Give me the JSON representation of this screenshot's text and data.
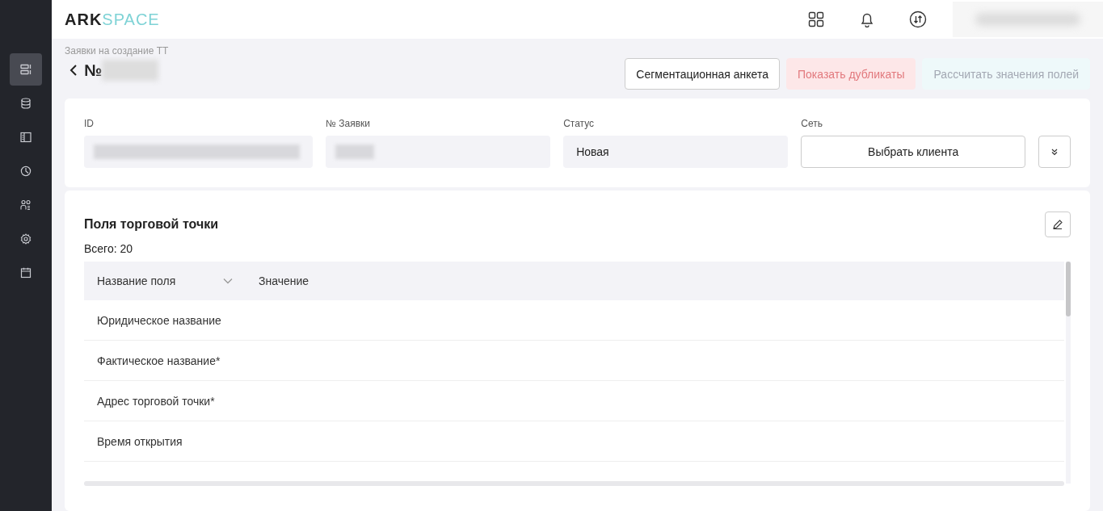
{
  "logo": {
    "part_1": "ARK",
    "part_2": "SPACE"
  },
  "sidebar": {
    "items": [
      {
        "selected": true
      },
      {
        "selected": false
      },
      {
        "selected": false
      },
      {
        "selected": false
      },
      {
        "selected": false
      },
      {
        "selected": false
      },
      {
        "selected": false
      }
    ]
  },
  "breadcrumb": "Заявки на создание ТТ",
  "page_title": "№",
  "actions": [
    {
      "label": "Сегментационная анкета",
      "kind": "outline",
      "disabled": false
    },
    {
      "label": "Показать дубликаты",
      "kind": "danger",
      "disabled": true
    },
    {
      "label": "Рассчитать значения полей",
      "kind": "secondary",
      "disabled": true
    }
  ],
  "fields": [
    {
      "label": "ID",
      "kind": "redacted"
    },
    {
      "label": "№ Заявки",
      "kind": "redacted_short"
    },
    {
      "label": "Статус",
      "kind": "text",
      "value": "Новая"
    },
    {
      "label": "Сеть",
      "kind": "button",
      "value": "Выбрать клиента"
    }
  ],
  "fields_panel": {
    "title": "Поля торговой точки",
    "total": "Всего: 20",
    "columns": [
      {
        "label": "Название поля",
        "sortable": true
      },
      {
        "label": "Значение",
        "sortable": false
      }
    ],
    "rows": [
      "Юридическое название",
      "Фактическое название*",
      "Адрес торговой точки*",
      "Время открытия"
    ]
  }
}
